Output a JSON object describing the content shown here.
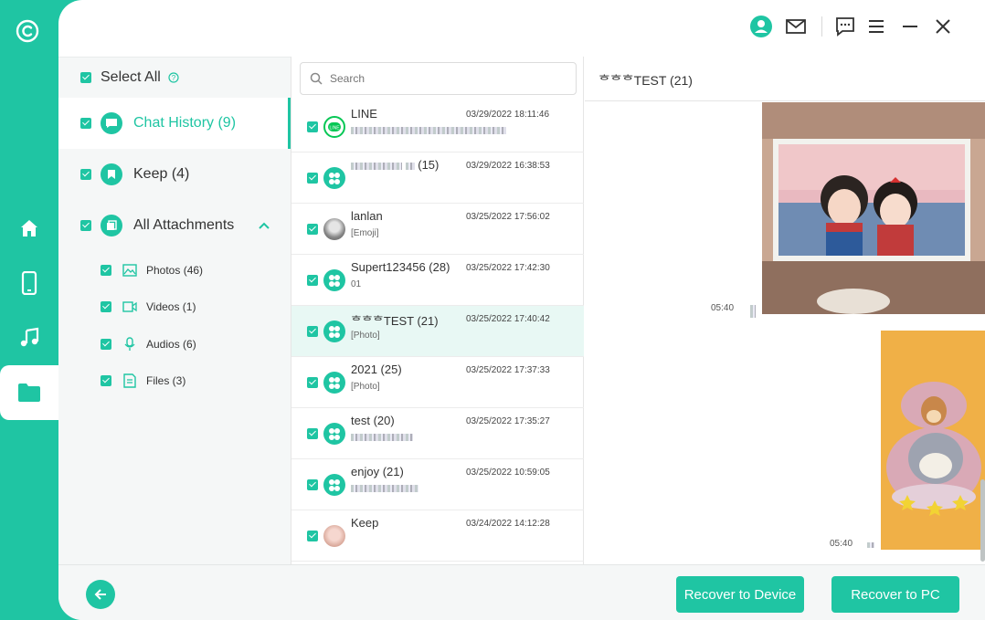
{
  "header": {
    "icons": [
      "user-avatar-icon",
      "mail-icon",
      "feedback-icon",
      "menu-icon",
      "minimize-icon",
      "close-icon"
    ]
  },
  "sidebar": {
    "icons": [
      "logo-icon",
      "home-icon",
      "device-icon",
      "music-icon",
      "folder-icon"
    ],
    "active": "folder-icon"
  },
  "categories": {
    "select_all": "Select All",
    "chat_history": "Chat History (9)",
    "keep": "Keep (4)",
    "all_attachments": "All Attachments",
    "sub": [
      {
        "label": "Photos (46)",
        "icon": "photo-icon"
      },
      {
        "label": "Videos (1)",
        "icon": "video-icon"
      },
      {
        "label": "Audios (6)",
        "icon": "microphone-icon"
      },
      {
        "label": "Files (3)",
        "icon": "file-icon"
      }
    ]
  },
  "search": {
    "placeholder": "Search"
  },
  "chats": [
    {
      "name": "LINE",
      "sub": "",
      "time": "03/29/2022 18:11:46"
    },
    {
      "name": "(15)",
      "sub": "",
      "time": "03/29/2022 16:38:53"
    },
    {
      "name": "lanlan",
      "sub": "[Emoji]",
      "time": "03/25/2022 17:56:02"
    },
    {
      "name": "Supert123456 (28)",
      "sub": "01",
      "time": "03/25/2022 17:42:30"
    },
    {
      "name": "ᄒᄒᄒTEST (21)",
      "sub": "[Photo]",
      "time": "03/25/2022 17:40:42"
    },
    {
      "name": "2021 (25)",
      "sub": "[Photo]",
      "time": "03/25/2022 17:37:33"
    },
    {
      "name": "test (20)",
      "sub": "",
      "time": "03/25/2022 17:35:27"
    },
    {
      "name": "enjoy  (21)",
      "sub": "",
      "time": "03/25/2022 10:59:05"
    },
    {
      "name": "Keep",
      "sub": "",
      "time": "03/24/2022 14:12:28"
    }
  ],
  "conversation": {
    "title": "ᄒᄒᄒTEST (21)",
    "messages": [
      {
        "time": "05:40"
      },
      {
        "time": "05:40"
      }
    ]
  },
  "footer": {
    "recover_device": "Recover to Device",
    "recover_pc": "Recover to PC"
  },
  "colors": {
    "accent": "#1fc5a3"
  }
}
